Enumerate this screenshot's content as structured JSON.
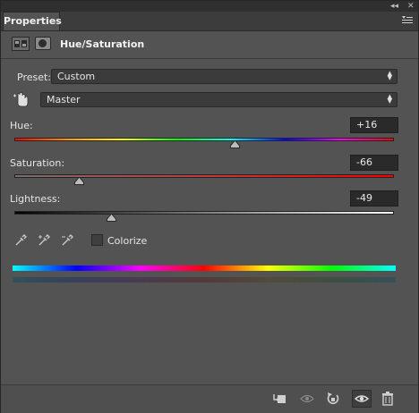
{
  "tab": {
    "label": "Properties"
  },
  "header": {
    "title": "Hue/Saturation"
  },
  "preset": {
    "label": "Preset:",
    "value": "Custom"
  },
  "range": {
    "value": "Master"
  },
  "hue": {
    "label": "Hue:",
    "value": "+16"
  },
  "saturation": {
    "label": "Saturation:",
    "value": "-66"
  },
  "lightness": {
    "label": "Lightness:",
    "value": "-49"
  },
  "colorize": {
    "label": "Colorize",
    "checked": false
  },
  "colors": {
    "panel": "#535353",
    "field": "#2a2a2a"
  }
}
